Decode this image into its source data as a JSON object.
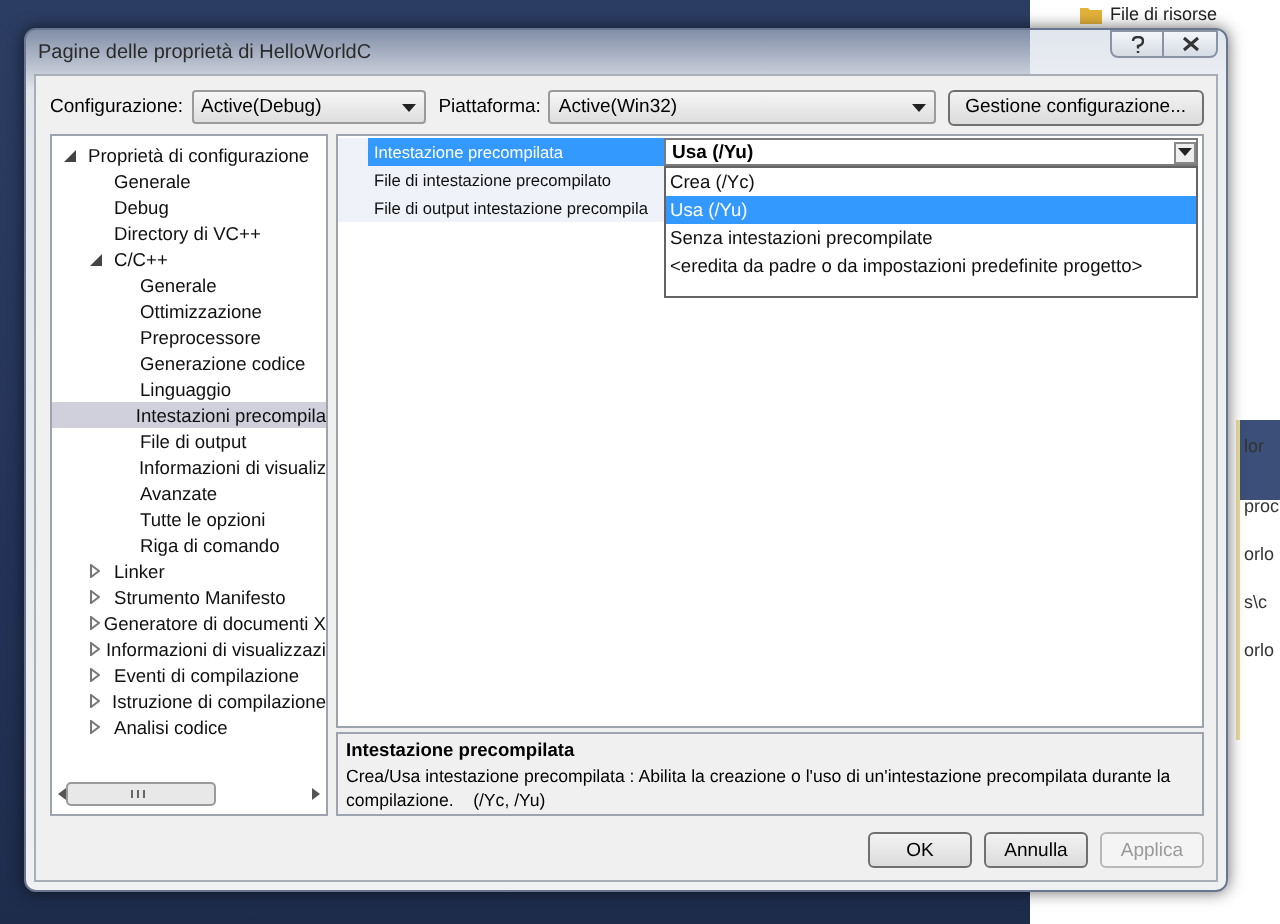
{
  "background": {
    "top_item": "File di risorse",
    "fragments": [
      "lor",
      "proc",
      "orlo",
      "s\\c",
      "orlo"
    ]
  },
  "window": {
    "title": "Pagine delle proprietà di HelloWorldC"
  },
  "toolbar": {
    "configuration_label": "Configurazione:",
    "configuration": "Active(Debug)",
    "platform_label": "Piattaforma:",
    "platform": "Active(Win32)",
    "manage_button": "Gestione configurazione..."
  },
  "tree": [
    {
      "label": "Proprietà di configurazione",
      "expanded": true,
      "selected": false,
      "children": [
        {
          "label": "Generale",
          "selected": false
        },
        {
          "label": "Debug",
          "selected": false
        },
        {
          "label": "Directory di VC++",
          "selected": false
        },
        {
          "label": "C/C++",
          "expanded": true,
          "selected": false,
          "children": [
            {
              "label": "Generale",
              "selected": false
            },
            {
              "label": "Ottimizzazione",
              "selected": false
            },
            {
              "label": "Preprocessore",
              "selected": false
            },
            {
              "label": "Generazione codice",
              "selected": false
            },
            {
              "label": "Linguaggio",
              "selected": false
            },
            {
              "label": "Intestazioni precompila",
              "selected": true
            },
            {
              "label": "File di output",
              "selected": false
            },
            {
              "label": "Informazioni di visualiz",
              "selected": false
            },
            {
              "label": "Avanzate",
              "selected": false
            },
            {
              "label": "Tutte le opzioni",
              "selected": false
            },
            {
              "label": "Riga di comando",
              "selected": false
            }
          ]
        },
        {
          "label": "Linker",
          "expanded": false,
          "selected": false
        },
        {
          "label": "Strumento Manifesto",
          "expanded": false,
          "selected": false
        },
        {
          "label": "Generatore di documenti X",
          "expanded": false,
          "selected": false
        },
        {
          "label": "Informazioni di visualizzazi",
          "expanded": false,
          "selected": false
        },
        {
          "label": "Eventi di compilazione",
          "expanded": false,
          "selected": false
        },
        {
          "label": "Istruzione di compilazione",
          "expanded": false,
          "selected": false
        },
        {
          "label": "Analisi codice",
          "expanded": false,
          "selected": false
        }
      ]
    }
  ],
  "grid": {
    "rows": [
      {
        "name": "Intestazione precompilata",
        "value": "Usa (/Yu)",
        "selected": true
      },
      {
        "name": "File di intestazione precompilato",
        "selected": false
      },
      {
        "name": "File di output intestazione precompila",
        "selected": false
      }
    ]
  },
  "dropdown": {
    "options": [
      {
        "label": "Crea (/Yc)",
        "selected": false
      },
      {
        "label": "Usa (/Yu)",
        "selected": true
      },
      {
        "label": "Senza intestazioni precompilate",
        "selected": false
      },
      {
        "label": "<eredita da padre o da impostazioni predefinite progetto>",
        "selected": false
      }
    ]
  },
  "description": {
    "title": "Intestazione precompilata",
    "text": "Crea/Usa intestazione precompilata : Abilita la creazione o l'uso di un'intestazione precompilata durante la compilazione.    (/Yc, /Yu)"
  },
  "buttons": [
    {
      "label": "OK",
      "disabled": false
    },
    {
      "label": "Annulla",
      "disabled": false
    },
    {
      "label": "Applica",
      "disabled": true
    }
  ]
}
